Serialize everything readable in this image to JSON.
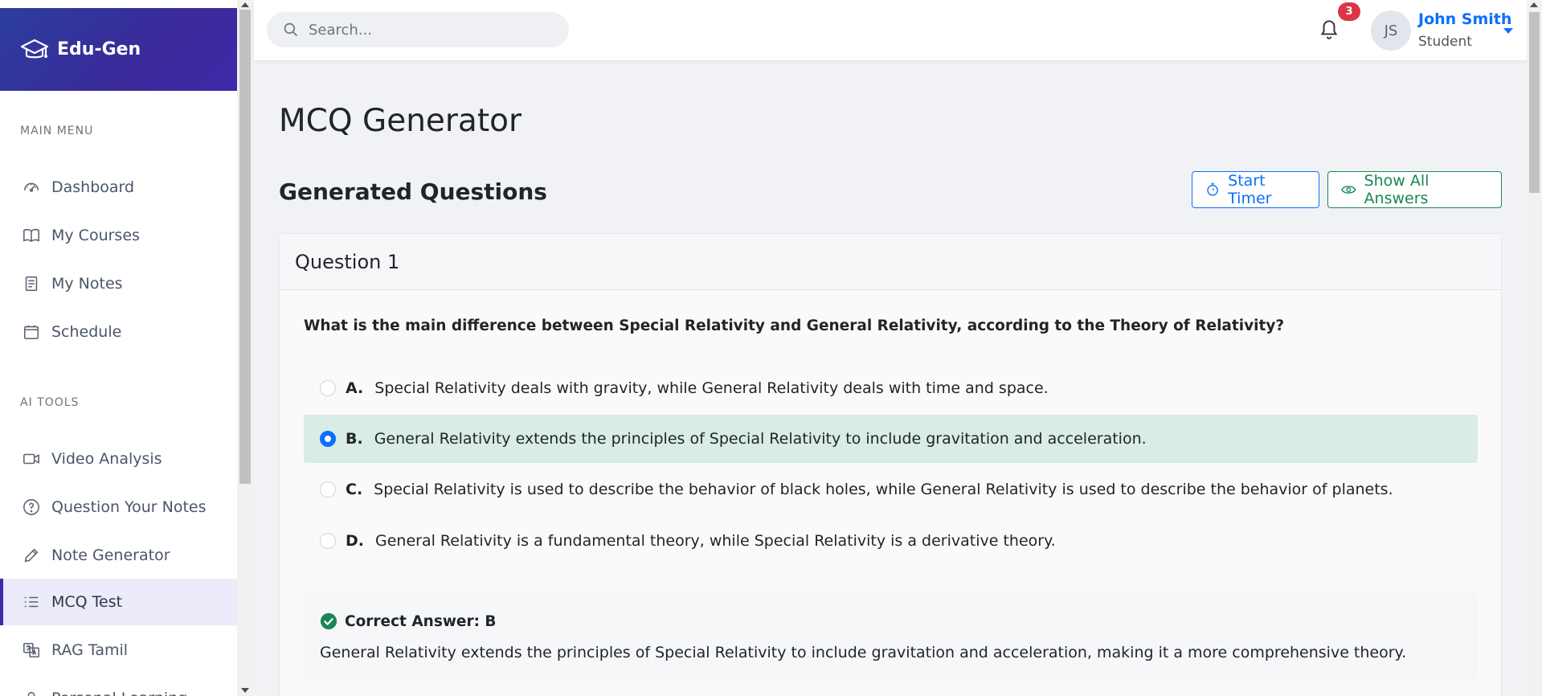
{
  "brand": {
    "name": "Edu-Gen"
  },
  "sidebar": {
    "sections": [
      {
        "title": "MAIN MENU"
      },
      {
        "title": "AI TOOLS"
      }
    ],
    "main_items": [
      {
        "label": "Dashboard",
        "icon": "gauge-icon"
      },
      {
        "label": "My Courses",
        "icon": "book-icon"
      },
      {
        "label": "My Notes",
        "icon": "notes-icon"
      },
      {
        "label": "Schedule",
        "icon": "calendar-icon"
      }
    ],
    "tool_items": [
      {
        "label": "Video Analysis",
        "icon": "video-icon"
      },
      {
        "label": "Question Your Notes",
        "icon": "question-circle-icon"
      },
      {
        "label": "Note Generator",
        "icon": "pencil-icon"
      },
      {
        "label": "MCQ Test",
        "icon": "list-icon",
        "active": true
      },
      {
        "label": "RAG Tamil",
        "icon": "translate-icon"
      },
      {
        "label": "Personal Learning",
        "icon": "person-icon"
      }
    ]
  },
  "header": {
    "search_placeholder": "Search...",
    "search_value": "",
    "notification_count": "3",
    "user": {
      "initials": "JS",
      "name": "John Smith",
      "role": "Student"
    }
  },
  "main": {
    "page_title": "MCQ Generator",
    "section_heading": "Generated Questions",
    "start_timer_label": "Start Timer",
    "show_answers_label": "Show All Answers"
  },
  "question": {
    "header": "Question 1",
    "text": "What is the main difference between Special Relativity and General Relativity, according to the Theory of Relativity?",
    "options": [
      {
        "letter": "A.",
        "text": "Special Relativity deals with gravity, while General Relativity deals with time and space.",
        "selected": false
      },
      {
        "letter": "B.",
        "text": "General Relativity extends the principles of Special Relativity to include gravitation and acceleration.",
        "selected": true
      },
      {
        "letter": "C.",
        "text": "Special Relativity is used to describe the behavior of black holes, while General Relativity is used to describe the behavior of planets.",
        "selected": false
      },
      {
        "letter": "D.",
        "text": "General Relativity is a fundamental theory, while Special Relativity is a derivative theory.",
        "selected": false
      }
    ],
    "correct_answer_label": "Correct Answer: B",
    "explanation": "General Relativity extends the principles of Special Relativity to include gravitation and acceleration, making it a more comprehensive theory."
  },
  "colors": {
    "brand_gradient_start": "#2c3e9e",
    "brand_gradient_end": "#3f2aa8",
    "primary": "#0d6efd",
    "success": "#198754",
    "danger": "#dc3545",
    "selected_option_bg": "#d9ece6"
  }
}
